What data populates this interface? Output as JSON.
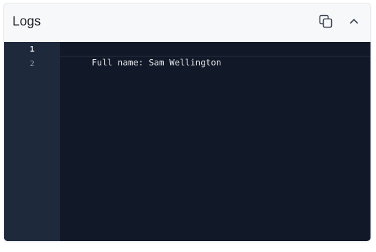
{
  "header": {
    "title": "Logs",
    "copy_icon": "copy-icon",
    "collapse_icon": "chevron-up-icon"
  },
  "editor": {
    "lines": [
      {
        "number": "1",
        "text": "Full name: Sam Wellington"
      },
      {
        "number": "2",
        "text": ""
      }
    ]
  },
  "colors": {
    "editor_bg": "#111827",
    "gutter_bg": "#1e293b",
    "header_bg": "#f7f8fa"
  }
}
